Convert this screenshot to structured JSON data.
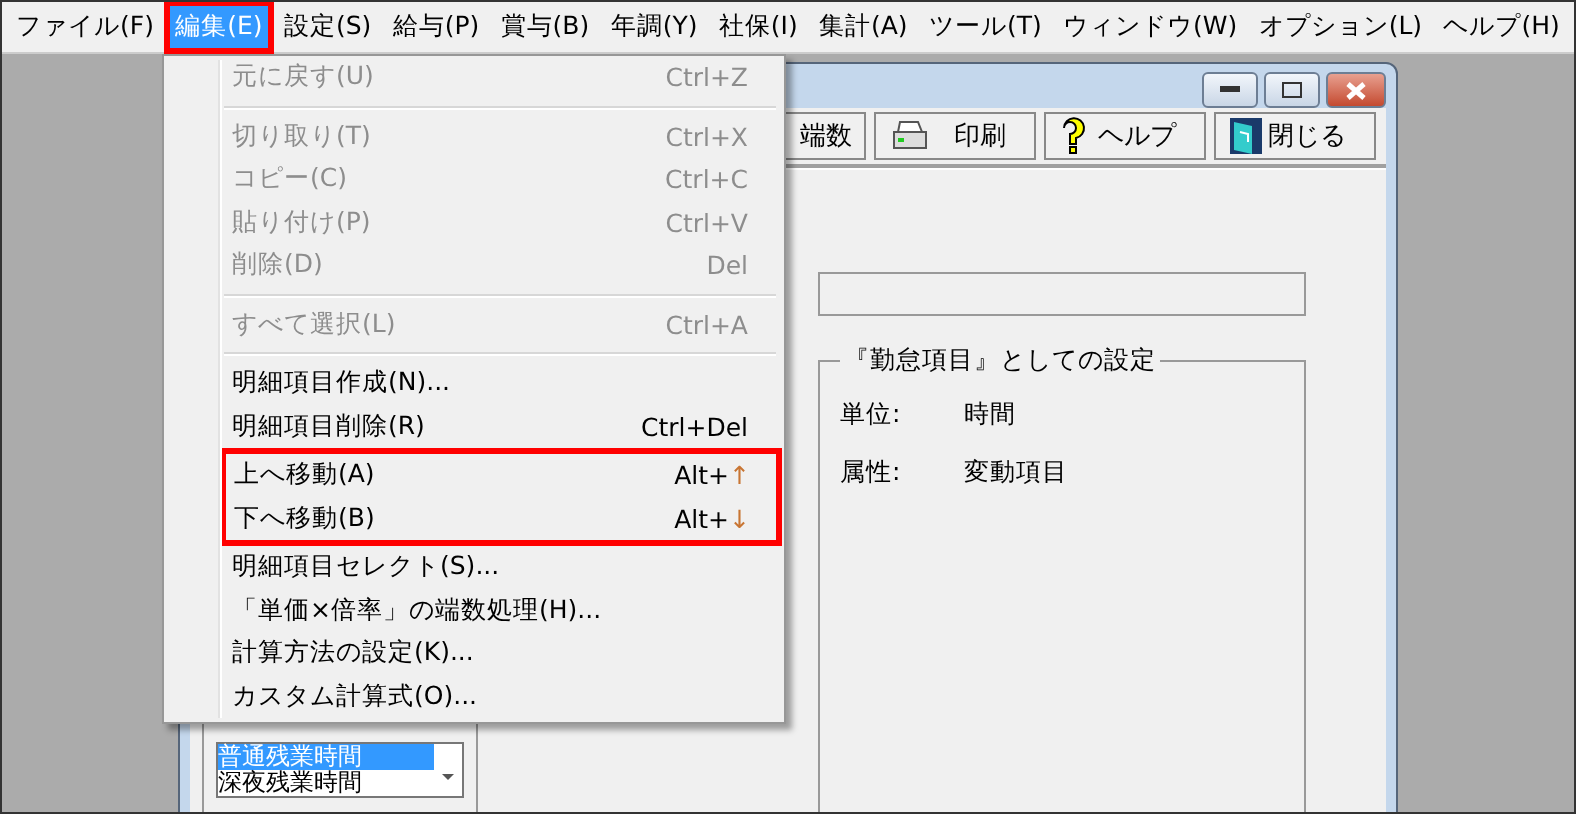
{
  "menubar": [
    {
      "label": "ファイル(F)",
      "selected": false,
      "annotated": false
    },
    {
      "label": "編集(E)",
      "selected": true,
      "annotated": true
    },
    {
      "label": "設定(S)",
      "selected": false,
      "annotated": false
    },
    {
      "label": "給与(P)",
      "selected": false,
      "annotated": false
    },
    {
      "label": "賞与(B)",
      "selected": false,
      "annotated": false
    },
    {
      "label": "年調(Y)",
      "selected": false,
      "annotated": false
    },
    {
      "label": "社保(I)",
      "selected": false,
      "annotated": false
    },
    {
      "label": "集計(A)",
      "selected": false,
      "annotated": false
    },
    {
      "label": "ツール(T)",
      "selected": false,
      "annotated": false
    },
    {
      "label": "ウィンドウ(W)",
      "selected": false,
      "annotated": false
    },
    {
      "label": "オプション(L)",
      "selected": false,
      "annotated": false
    },
    {
      "label": "ヘルプ(H)",
      "selected": false,
      "annotated": false
    }
  ],
  "menu": [
    {
      "kind": "item",
      "label": "元に戻す(U)",
      "shortcut": "Ctrl+Z",
      "disabled": true,
      "annotated": false
    },
    {
      "kind": "separator"
    },
    {
      "kind": "item",
      "label": "切り取り(T)",
      "shortcut": "Ctrl+X",
      "disabled": true,
      "annotated": false
    },
    {
      "kind": "item",
      "label": "コピー(C)",
      "shortcut": "Ctrl+C",
      "disabled": true,
      "annotated": false
    },
    {
      "kind": "item",
      "label": "貼り付け(P)",
      "shortcut": "Ctrl+V",
      "disabled": true,
      "annotated": false
    },
    {
      "kind": "item",
      "label": "削除(D)",
      "shortcut": "Del",
      "disabled": true,
      "annotated": false
    },
    {
      "kind": "separator"
    },
    {
      "kind": "item",
      "label": "すべて選択(L)",
      "shortcut": "Ctrl+A",
      "disabled": true,
      "annotated": false
    },
    {
      "kind": "separator"
    },
    {
      "kind": "item",
      "label": "明細項目作成(N)...",
      "disabled": false,
      "annotated": false
    },
    {
      "kind": "item",
      "label": "明細項目削除(R)",
      "shortcut": "Ctrl+Del",
      "disabled": false,
      "annotated": false
    },
    {
      "kind": "item",
      "label": "上へ移動(A)",
      "shortcut": "Alt+",
      "arrow": "↑",
      "disabled": false,
      "annotated": true
    },
    {
      "kind": "item",
      "label": "下へ移動(B)",
      "shortcut": "Alt+",
      "arrow": "↓",
      "disabled": false,
      "annotated": true
    },
    {
      "kind": "item",
      "label": "明細項目セレクト(S)...",
      "disabled": false,
      "annotated": false
    },
    {
      "kind": "item",
      "label": "「単価×倍率」の端数処理(H)...",
      "disabled": false,
      "annotated": false
    },
    {
      "kind": "item",
      "label": "計算方法の設定(K)...",
      "disabled": false,
      "annotated": false
    },
    {
      "kind": "item",
      "label": "カスタム計算式(O)...",
      "disabled": false,
      "annotated": false
    }
  ],
  "toolbar": [
    {
      "label": "端数"
    },
    {
      "label": "印刷"
    },
    {
      "label": "ヘルプ"
    },
    {
      "label": "閉じる"
    }
  ],
  "settings_group": {
    "title": "『勤怠項目』としての設定",
    "rows": [
      {
        "label": "単位:",
        "value": "時間"
      },
      {
        "label": "属性:",
        "value": "変動項目"
      }
    ]
  },
  "item_list": [
    {
      "label": "普通残業時間",
      "selected": true
    },
    {
      "label": "深夜残業時間",
      "selected": false
    }
  ]
}
